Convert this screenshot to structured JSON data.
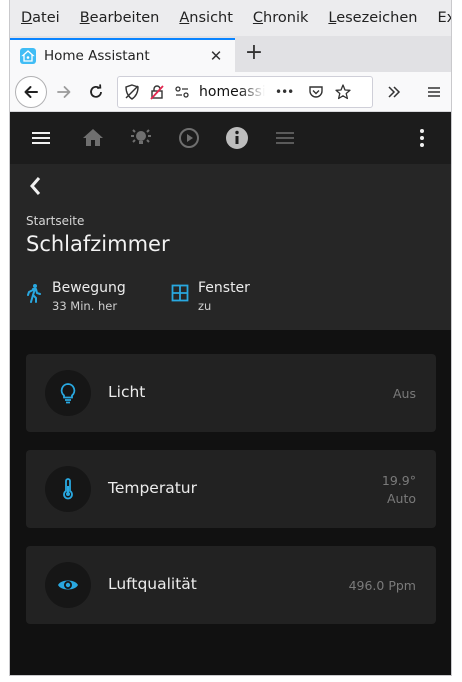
{
  "menubar": {
    "items": [
      {
        "accel": "D",
        "rest": "atei"
      },
      {
        "accel": "B",
        "rest": "earbeiten"
      },
      {
        "accel": "A",
        "rest": "nsicht"
      },
      {
        "accel": "C",
        "rest": "hronik"
      },
      {
        "accel": "L",
        "rest": "esezeichen"
      },
      {
        "accel": "",
        "rest": "Extra"
      }
    ]
  },
  "tab": {
    "title": "Home Assistant",
    "close": "✕"
  },
  "newtab": "+",
  "navbar": {
    "url": "homeassistant",
    "more": "•••"
  },
  "colors": {
    "accent": "#29a8e0",
    "background": "#111111",
    "header": "#262626",
    "card": "#222222"
  },
  "app": {
    "breadcrumb": "Startseite",
    "room": "Schlafzimmer",
    "badges": [
      {
        "icon": "walk-icon",
        "name": "Bewegung",
        "state": "33 Min. her"
      },
      {
        "icon": "window-icon",
        "name": "Fenster",
        "state": "zu"
      }
    ],
    "cards": [
      {
        "icon": "lightbulb-icon",
        "name": "Licht",
        "state": "Aus",
        "state2": ""
      },
      {
        "icon": "thermometer-icon",
        "name": "Temperatur",
        "state": "19.9°",
        "state2": "Auto"
      },
      {
        "icon": "eye-icon",
        "name": "Luftqualität",
        "state": "496.0 Ppm",
        "state2": ""
      }
    ]
  }
}
